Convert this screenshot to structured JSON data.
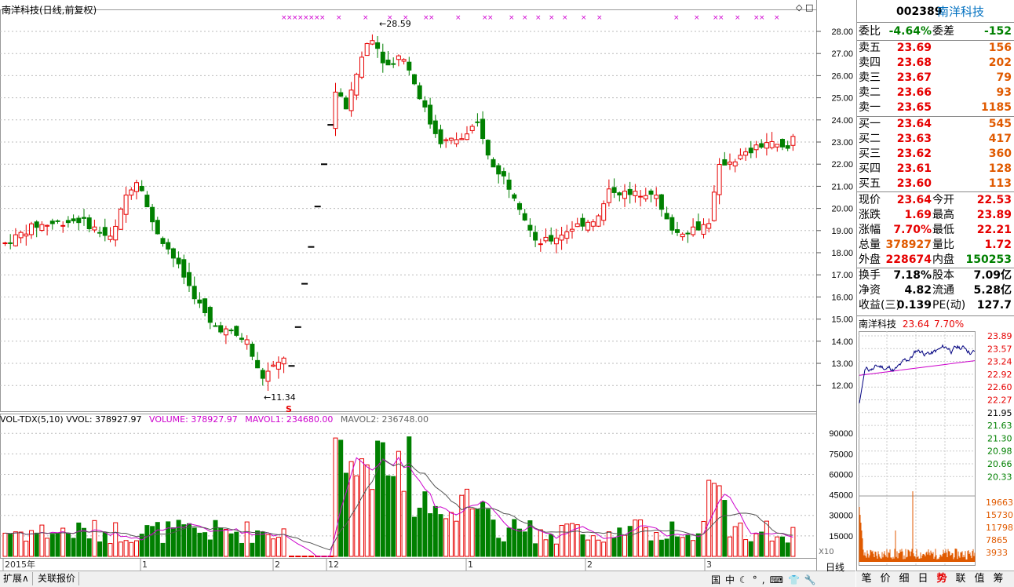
{
  "chart": {
    "title": "南洋科技(日线,前复权)",
    "high_label": "28.59",
    "low_label": "11.34",
    "s_marker": "S",
    "price_axis": [
      "28.00",
      "27.00",
      "26.00",
      "25.00",
      "24.00",
      "23.00",
      "22.00",
      "21.00",
      "20.00",
      "19.00",
      "18.00",
      "17.00",
      "16.00",
      "15.00",
      "14.00",
      "13.00",
      "12.00"
    ],
    "vol_legend": {
      "name": "VOL-TDX(5,10)",
      "vvol": "VVOL: 378927.97",
      "volume": "VOLUME: 378927.97",
      "mavol1": "MAVOL1: 234680.00",
      "mavol2": "MAVOL2: 236748.00"
    },
    "vol_axis": [
      "90000",
      "75000",
      "60000",
      "45000",
      "30000",
      "15000"
    ],
    "vol_unit": "X10",
    "date_labels": [
      "2015年",
      "1",
      "2",
      "12",
      "1",
      "2",
      "3"
    ],
    "period_label": "日线",
    "colors": {
      "up": "#e60000",
      "down": "#008000",
      "mavol1": "#cc00cc",
      "mavol2": "#555555"
    }
  },
  "bottom_tabs": [
    "扩展∧",
    "关联报价"
  ],
  "right": {
    "code": "002389",
    "name": "南洋科技",
    "weibi_label": "委比",
    "weibi": "-4.64%",
    "weicha_label": "委差",
    "weicha": "-152",
    "sell": [
      {
        "label": "卖五",
        "price": "23.69",
        "vol": "156"
      },
      {
        "label": "卖四",
        "price": "23.68",
        "vol": "202"
      },
      {
        "label": "卖三",
        "price": "23.67",
        "vol": "79"
      },
      {
        "label": "卖二",
        "price": "23.66",
        "vol": "93"
      },
      {
        "label": "卖一",
        "price": "23.65",
        "vol": "1185"
      }
    ],
    "buy": [
      {
        "label": "买一",
        "price": "23.64",
        "vol": "545"
      },
      {
        "label": "买二",
        "price": "23.63",
        "vol": "417"
      },
      {
        "label": "买三",
        "price": "23.62",
        "vol": "360"
      },
      {
        "label": "买四",
        "price": "23.61",
        "vol": "128"
      },
      {
        "label": "买五",
        "price": "23.60",
        "vol": "113"
      }
    ],
    "quote": [
      {
        "l1": "现价",
        "v1": "23.64",
        "l2": "今开",
        "v2": "22.53"
      },
      {
        "l1": "涨跌",
        "v1": "1.69",
        "l2": "最高",
        "v2": "23.89"
      },
      {
        "l1": "涨幅",
        "v1": "7.70%",
        "l2": "最低",
        "v2": "22.21"
      },
      {
        "l1": "总量",
        "v1": "378927",
        "l2": "量比",
        "v2": "1.72"
      },
      {
        "l1": "外盘",
        "v1": "228674",
        "l2": "内盘",
        "v2": "150253"
      }
    ],
    "fin": [
      {
        "l1": "换手",
        "v1": "7.18%",
        "l2": "股本",
        "v2": "7.09亿"
      },
      {
        "l1": "净资",
        "v1": "4.82",
        "l2": "流通",
        "v2": "5.28亿"
      },
      {
        "l1": "收益(三)",
        "v1": "0.139",
        "l2": "PE(动)",
        "v2": "127.7"
      }
    ],
    "mini": {
      "name": "南洋科技",
      "price": "23.64",
      "pct": "7.70%",
      "price_axis": [
        "23.89",
        "23.57",
        "23.24",
        "22.92",
        "22.60",
        "22.27",
        "21.95",
        "21.63",
        "21.30",
        "20.98",
        "20.66",
        "20.33"
      ],
      "vol_axis": [
        "19663",
        "15730",
        "11798",
        "7865",
        "3933"
      ]
    },
    "tabs": [
      "笔",
      "价",
      "细",
      "日",
      "势",
      "联",
      "值",
      "筹"
    ]
  },
  "tray_icons": [
    "国",
    "中",
    "☾",
    "°,",
    "⌨",
    "👕",
    "🔧"
  ]
}
